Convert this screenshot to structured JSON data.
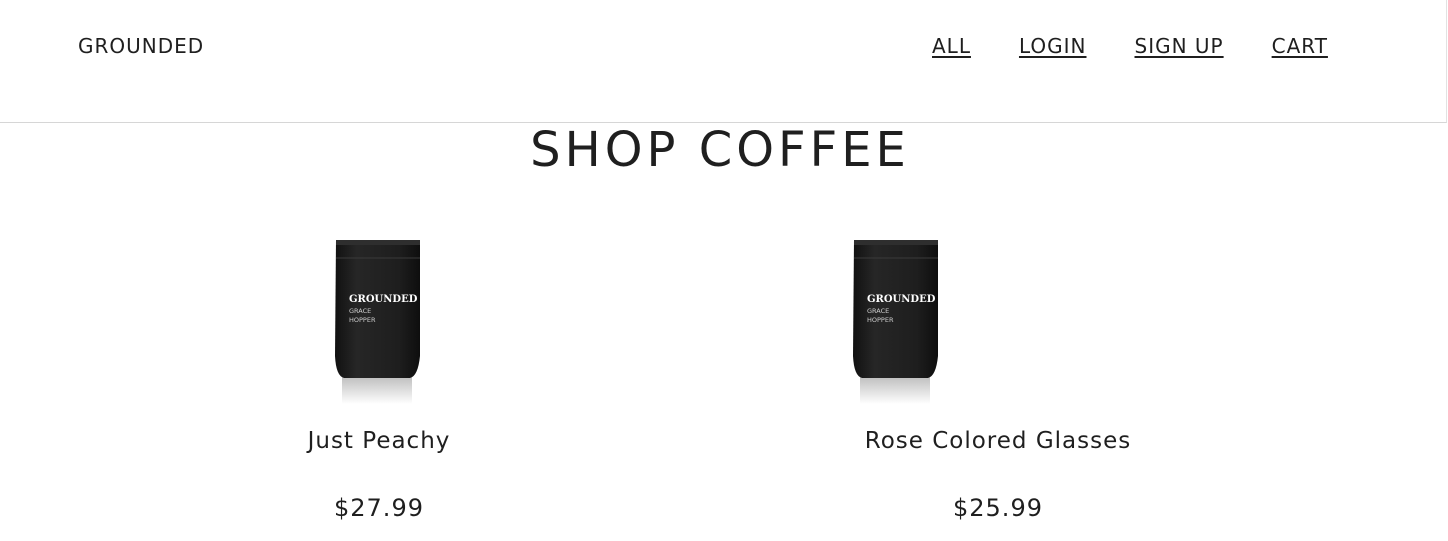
{
  "header": {
    "brand": "GROUNDED",
    "nav": [
      "ALL",
      "LOGIN",
      "SIGN UP",
      "CART"
    ]
  },
  "main": {
    "title": "SHOP COFFEE",
    "products": [
      {
        "name": "Just Peachy",
        "price": "$27.99",
        "bag_brand": "GROUNDED",
        "bag_line1": "GRACE",
        "bag_line2": "HOPPER"
      },
      {
        "name": "Rose Colored Glasses",
        "price": "$25.99",
        "bag_brand": "GROUNDED",
        "bag_line1": "GRACE",
        "bag_line2": "HOPPER"
      }
    ]
  },
  "colors": {
    "text": "#1f1f1f",
    "bag": "#1c1c1c",
    "divider": "#d6d6d6"
  }
}
